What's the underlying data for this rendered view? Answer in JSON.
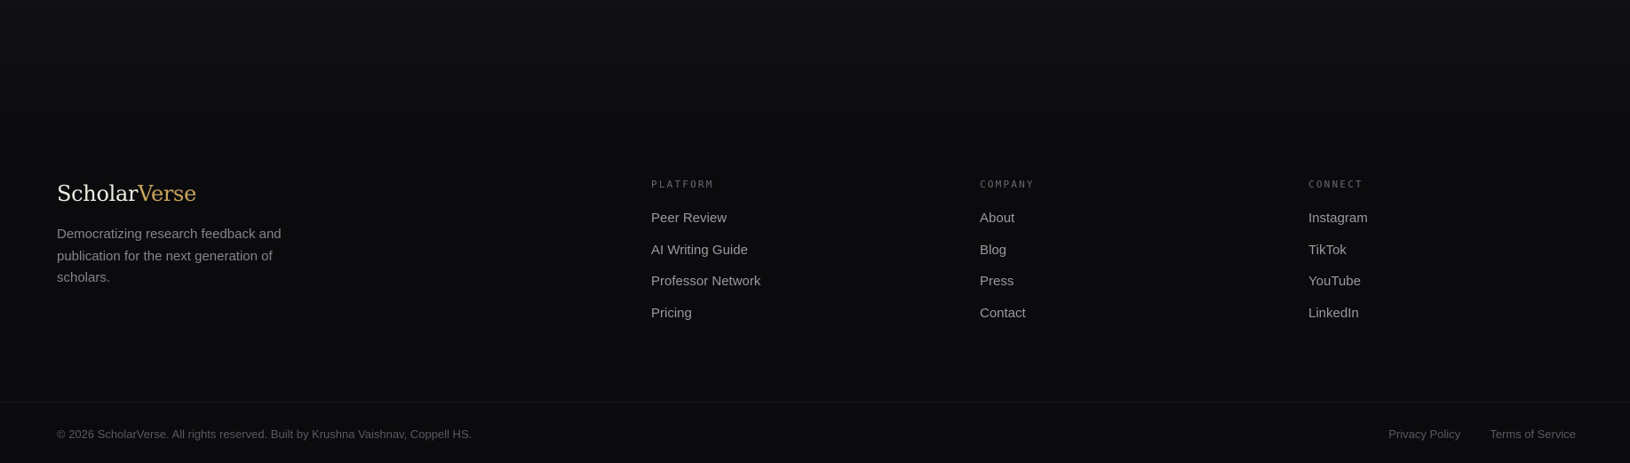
{
  "brand": {
    "name_part1": "Scholar",
    "name_part2": "Verse",
    "tagline": "Democratizing research feedback and publication for the next generation of scholars."
  },
  "columns": [
    {
      "title": "PLATFORM",
      "links": [
        "Peer Review",
        "AI Writing Guide",
        "Professor Network",
        "Pricing"
      ]
    },
    {
      "title": "COMPANY",
      "links": [
        "About",
        "Blog",
        "Press",
        "Contact"
      ]
    },
    {
      "title": "CONNECT",
      "links": [
        "Instagram",
        "TikTok",
        "YouTube",
        "LinkedIn"
      ]
    }
  ],
  "bottom": {
    "copyright": "© 2026 ScholarVerse. All rights reserved. Built by Krushna Vaishnav, Coppell HS.",
    "privacy": "Privacy Policy",
    "terms": "Terms of Service"
  },
  "colors": {
    "background": "#0b0b0d",
    "brand_accent": "#c9a45c",
    "brand_light": "#f0ece4"
  }
}
